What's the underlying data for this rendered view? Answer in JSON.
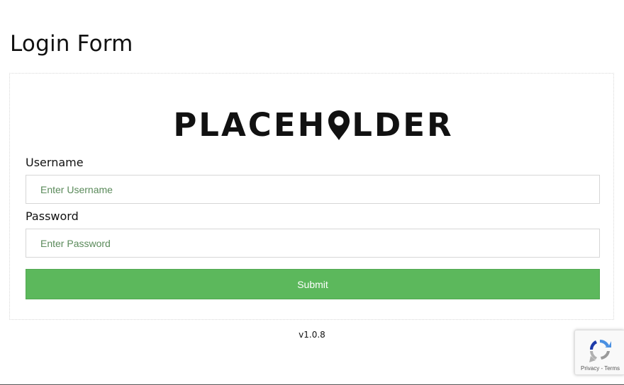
{
  "header": {
    "title": "Login Form"
  },
  "logo": {
    "text_before": "PLACEH",
    "text_after": "LDER",
    "icon": "map-pin-icon"
  },
  "form": {
    "username_label": "Username",
    "username_placeholder": "Enter Username",
    "username_value": "",
    "password_label": "Password",
    "password_placeholder": "Enter Password",
    "password_value": "",
    "submit_label": "Submit"
  },
  "footer": {
    "version": "v1.0.8"
  },
  "recaptcha": {
    "icon": "recaptcha-icon",
    "privacy_label": "Privacy",
    "separator": " - ",
    "terms_label": "Terms"
  },
  "colors": {
    "submit_bg": "#5cb85c",
    "placeholder_text": "#5a8a5a"
  }
}
